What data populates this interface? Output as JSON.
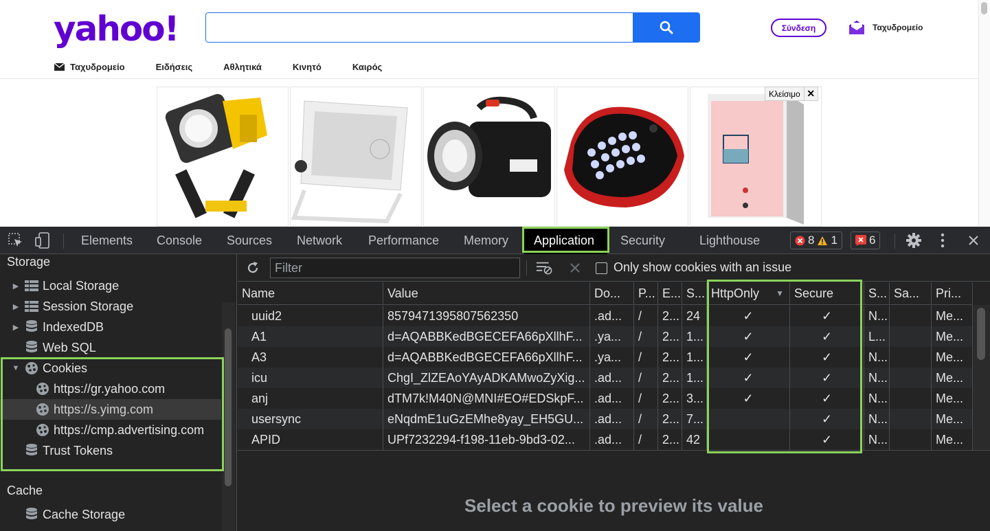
{
  "yahoo": {
    "logo": "yahoo!",
    "search_value": "",
    "search_icon": "search-icon",
    "signin_label": "Σύνδεση",
    "mail_label": "Ταχυδρομείο",
    "nav": [
      {
        "label": "Ταχυδρομείο",
        "icon": "envelope-icon"
      },
      {
        "label": "Ειδήσεις"
      },
      {
        "label": "Αθλητικά"
      },
      {
        "label": "Κινητό"
      },
      {
        "label": "Καιρός"
      }
    ],
    "ad_close_label": "Κλείσιμο",
    "ad_close_x": "✕"
  },
  "devtools": {
    "tabs": [
      "Elements",
      "Console",
      "Sources",
      "Network",
      "Performance",
      "Memory",
      "Application",
      "Security",
      "Lighthouse"
    ],
    "active_tab": "Application",
    "errors_count": "8",
    "warnings_count": "1",
    "issues_count": "6",
    "sidebar": {
      "storage_heading": "Storage",
      "items": {
        "local_storage": "Local Storage",
        "session_storage": "Session Storage",
        "indexeddb": "IndexedDB",
        "websql": "Web SQL",
        "cookies": "Cookies",
        "cookie_gr": "https://gr.yahoo.com",
        "cookie_yimg": "https://s.yimg.com",
        "cookie_cmp": "https://cmp.advertising.com",
        "trust_tokens": "Trust Tokens"
      },
      "cache_heading": "Cache",
      "cache_storage": "Cache Storage"
    },
    "toolbar": {
      "filter_placeholder": "Filter",
      "only_issues_label": "Only show cookies with an issue"
    },
    "columns": [
      "Name",
      "Value",
      "Do...",
      "P...",
      "E...",
      "S...",
      "HttpOnly",
      "Secure",
      "S...",
      "Sa...",
      "Pri..."
    ],
    "cookies": [
      [
        "uuid2",
        "8579471395807562350",
        ".ad...",
        "/",
        "2...",
        "24",
        "✓",
        "✓",
        "N...",
        "",
        "Me..."
      ],
      [
        "A1",
        "d=AQABBKedBGECEFA66pXllhF...",
        ".ya...",
        "/",
        "2...",
        "1...",
        "✓",
        "✓",
        "L...",
        "",
        "Me..."
      ],
      [
        "A3",
        "d=AQABBKedBGECEFA66pXllhF...",
        ".ya...",
        "/",
        "2...",
        "1...",
        "✓",
        "✓",
        "N...",
        "",
        "Me..."
      ],
      [
        "icu",
        "ChgI_ZlZEAoYAyADKAMwoZyXig...",
        ".ad...",
        "/",
        "2...",
        "1...",
        "✓",
        "✓",
        "N...",
        "",
        "Me..."
      ],
      [
        "anj",
        "dTM7k!M40N@MNI#EO#EDSkpF...",
        ".ad...",
        "/",
        "2...",
        "3...",
        "✓",
        "✓",
        "N...",
        "",
        "Me..."
      ],
      [
        "usersync",
        "eNqdmE1uGzEMhe8yay_EH5GU...",
        ".ad...",
        "/",
        "2...",
        "7...",
        "",
        "✓",
        "N...",
        "",
        "Me..."
      ],
      [
        "APID",
        "UPf7232294-f198-11eb-9bd3-02...",
        ".ad...",
        "/",
        "2...",
        "42",
        "",
        "✓",
        "N...",
        "",
        "Me..."
      ]
    ],
    "preview_message": "Select a cookie to preview its value"
  },
  "colors": {
    "yahoo_purple": "#6001d2",
    "search_blue": "#1d6ef0",
    "highlight_green": "#8bd35b",
    "devtools_bg": "#242424"
  }
}
